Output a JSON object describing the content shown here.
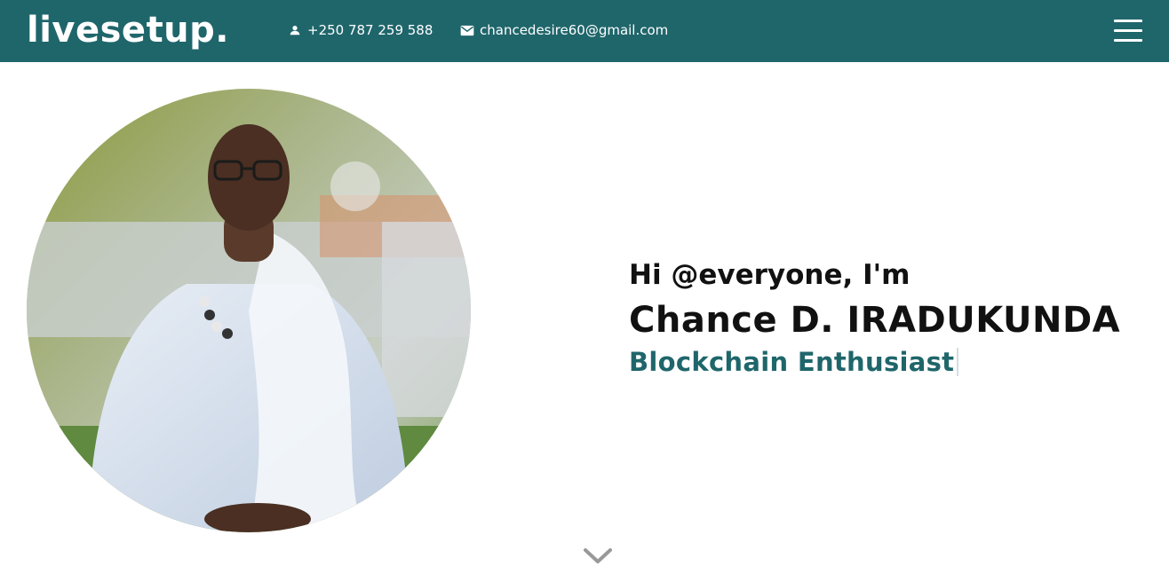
{
  "navbar": {
    "logo": "livesetup.",
    "phone": "+250 787 259 588",
    "email": "chancedesire60@gmail.com",
    "phone_icon": "person-icon",
    "email_icon": "mail-icon",
    "menu_icon": "hamburger-menu-icon"
  },
  "hero": {
    "greeting": "Hi @everyone, I'm",
    "name": "Chance D. IRADUKUNDA",
    "role": "Blockchain Enthusiast",
    "scroll_icon": "chevron-down-icon"
  },
  "colors": {
    "navbar": "#1f666b",
    "accent": "#1f666b",
    "text": "#111111",
    "background": "#ffffff"
  }
}
